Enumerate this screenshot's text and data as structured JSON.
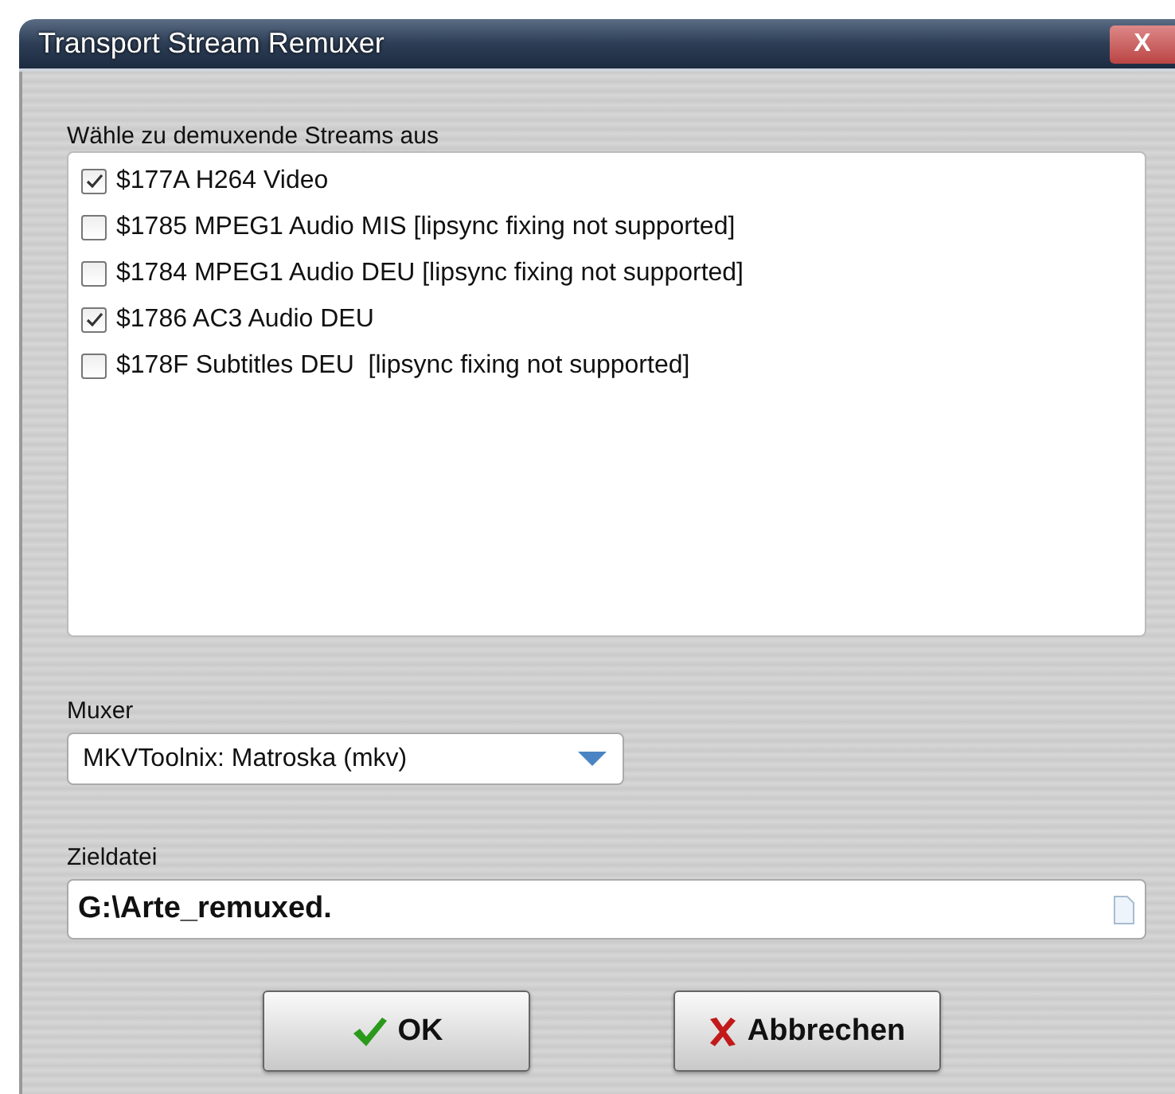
{
  "window": {
    "title": "Transport Stream Remuxer",
    "close_label": "X"
  },
  "streams": {
    "label": "Wähle zu demuxende Streams aus",
    "items": [
      {
        "label": "$177A H264 Video",
        "checked": true
      },
      {
        "label": "$1785 MPEG1 Audio MIS [lipsync fixing not supported]",
        "checked": false
      },
      {
        "label": "$1784 MPEG1 Audio DEU [lipsync fixing not supported]",
        "checked": false
      },
      {
        "label": "$1786 AC3 Audio DEU",
        "checked": true
      },
      {
        "label": "$178F Subtitles DEU  [lipsync fixing not supported]",
        "checked": false
      }
    ]
  },
  "muxer": {
    "label": "Muxer",
    "value": "MKVToolnix: Matroska (mkv)"
  },
  "target": {
    "label": "Zieldatei",
    "value": "G:\\Arte_remuxed."
  },
  "buttons": [
    {
      "kind": "ok",
      "label": "OK"
    },
    {
      "kind": "cancel",
      "label": "Abbrechen"
    }
  ]
}
